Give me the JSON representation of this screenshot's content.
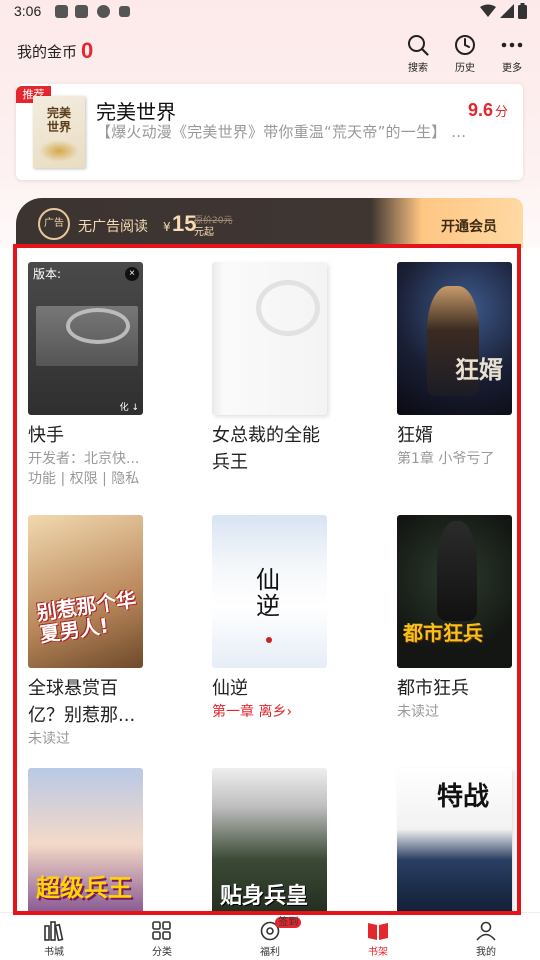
{
  "status_bar": {
    "time": "3:06"
  },
  "header": {
    "coins_label": "我的金币",
    "coins_value": "0",
    "search_label": "搜索",
    "history_label": "历史",
    "more_label": "更多"
  },
  "recommend": {
    "badge": "推荐",
    "cover_title": "完美世界",
    "title": "完美世界",
    "score": "9.6",
    "score_unit": "分",
    "description": "【爆火动漫《完美世界》带你重温“荒天帝”的一生】 ..."
  },
  "vip": {
    "icon_text": "广告",
    "no_ads": "无广告阅读",
    "currency": "¥",
    "price": "15",
    "original_price": "原价20元",
    "price_suffix": "元起",
    "open_label": "开通会员"
  },
  "books": [
    {
      "title": "快手",
      "cover_label": "版本:",
      "line1": "开发者：北京快...",
      "line2": "功能 | 权限 | 隐私",
      "cover_corner": "化 ↓"
    },
    {
      "title": "女总裁的全能兵王",
      "status": ""
    },
    {
      "title": "狂婿",
      "cover_title": "狂婿",
      "status": "第1章  小爷亏了"
    },
    {
      "title": "全球悬赏百亿？别惹那...",
      "cover_title": "别惹那个华夏男人!",
      "status": "未读过"
    },
    {
      "title": "仙逆",
      "cover_title": "仙逆",
      "status": "第一章 离乡›"
    },
    {
      "title": "都市狂兵",
      "cover_title": "都市狂兵",
      "status": "未读过"
    },
    {
      "title": "",
      "cover_title": "超级兵王"
    },
    {
      "title": "",
      "cover_title": "贴身兵皇"
    },
    {
      "title": "",
      "cover_title": "特战"
    }
  ],
  "bottom_nav": [
    {
      "label": "书城",
      "icon": "bookstore-icon"
    },
    {
      "label": "分类",
      "icon": "category-icon"
    },
    {
      "label": "福利",
      "icon": "welfare-icon",
      "badge": "签到"
    },
    {
      "label": "书架",
      "icon": "bookshelf-icon",
      "active": true
    },
    {
      "label": "我的",
      "icon": "profile-icon"
    }
  ],
  "colors": {
    "accent": "#e4262d",
    "vip_dark": "#3d3532",
    "vip_gold": "#ffd9a3"
  }
}
